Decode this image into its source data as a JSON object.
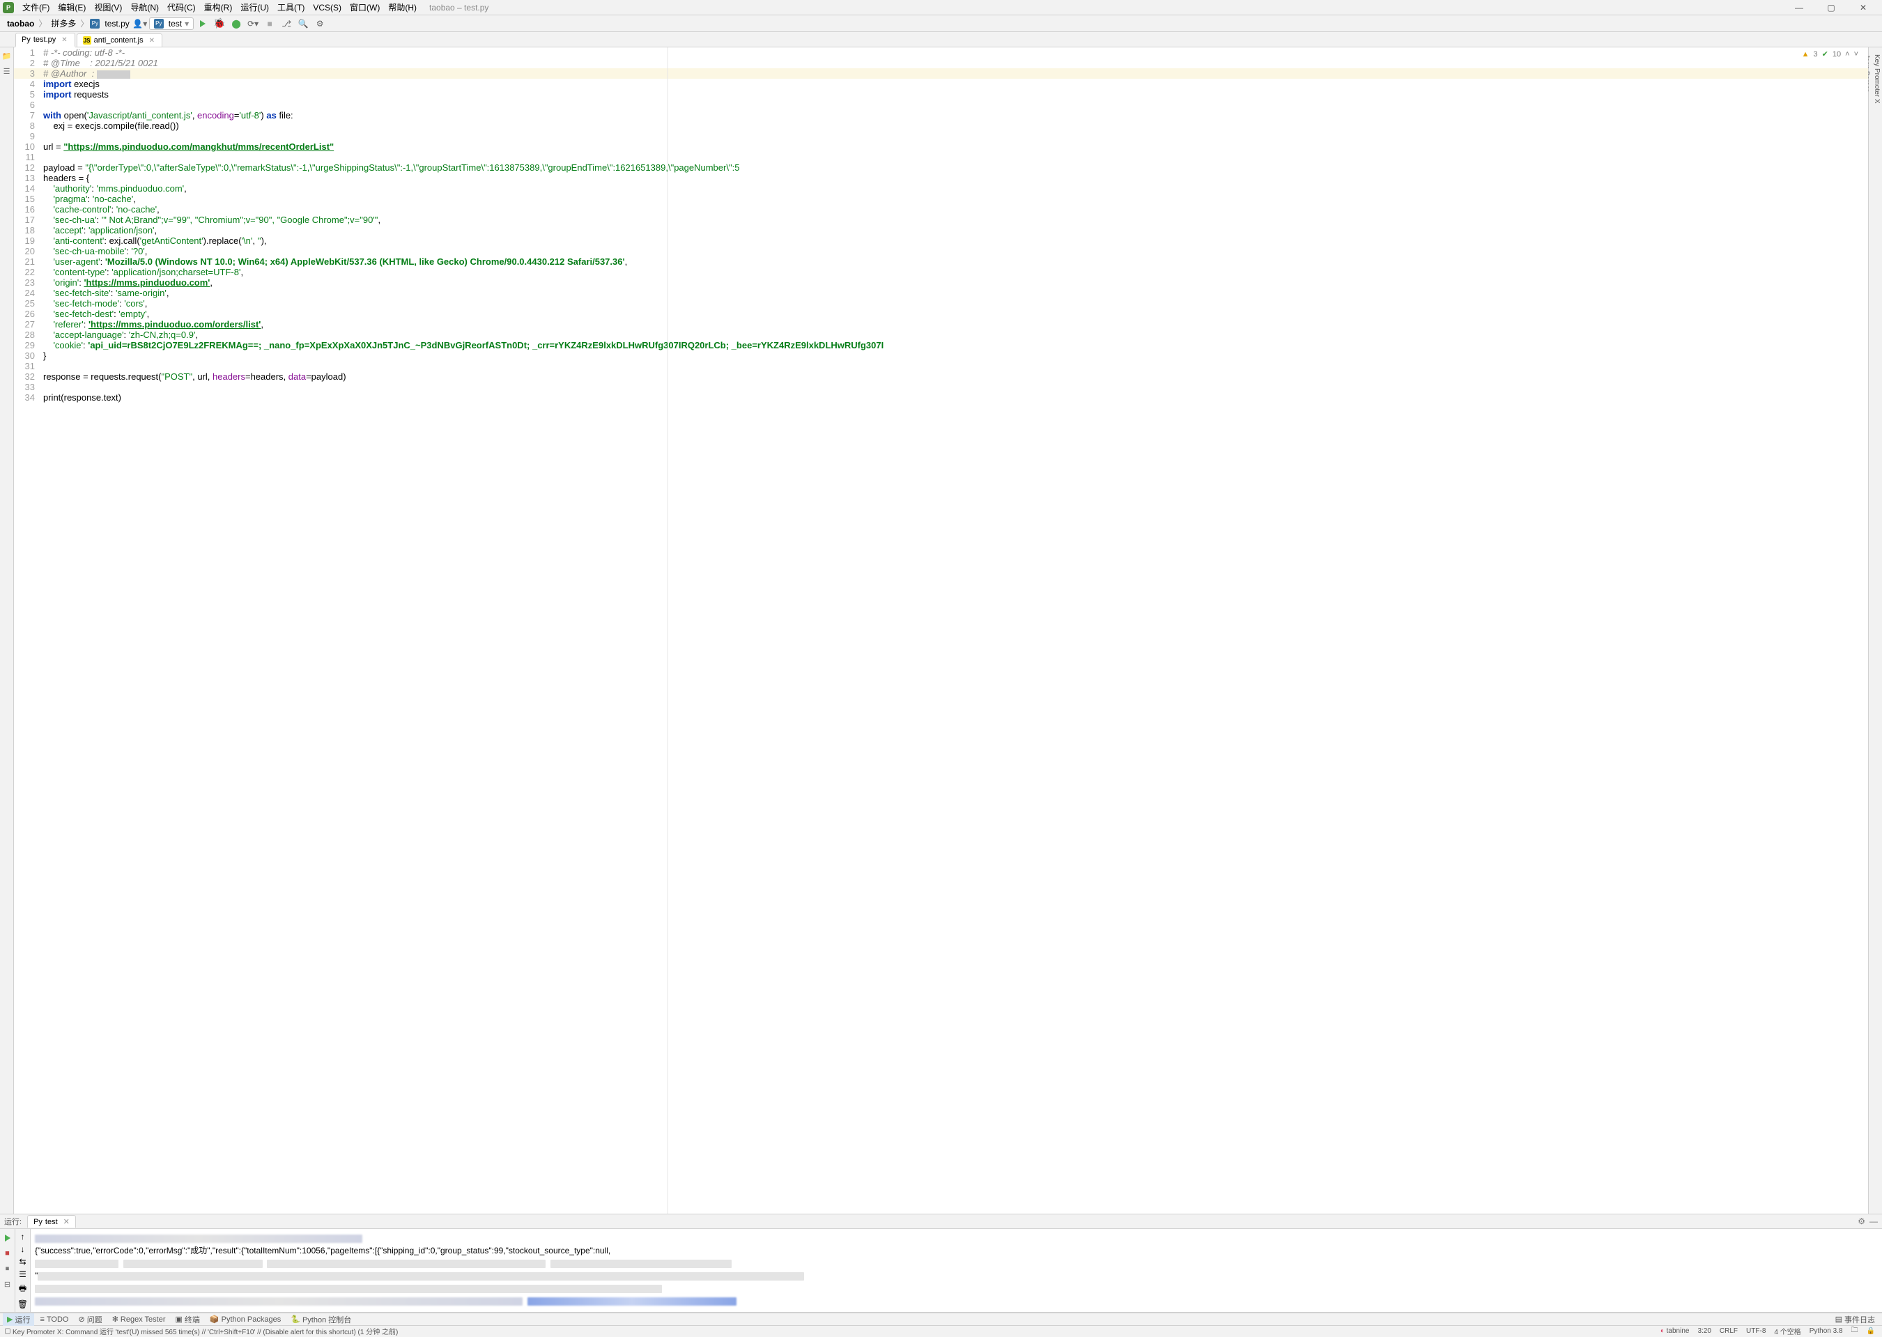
{
  "window": {
    "title": "taobao – test.py"
  },
  "menu": {
    "items": [
      "文件(F)",
      "编辑(E)",
      "视图(V)",
      "导航(N)",
      "代码(C)",
      "重构(R)",
      "运行(U)",
      "工具(T)",
      "VCS(S)",
      "窗口(W)",
      "帮助(H)"
    ]
  },
  "breadcrumb": {
    "a": "taobao",
    "b": "拼多多",
    "c": "test.py"
  },
  "run": {
    "conf": "test"
  },
  "tabs": [
    {
      "icon": "py",
      "label": "test.py",
      "active": true
    },
    {
      "icon": "js",
      "label": "anti_content.js",
      "active": false
    }
  ],
  "inspection": {
    "warnings": "3",
    "ok": "10"
  },
  "code": {
    "l1": "# -*- coding: utf-8 -*-",
    "l2": "# @Time    : 2021/5/21 0021",
    "l3a": "# @Author  : ",
    "l5_1": "import",
    "l5_2": " execjs",
    "l6_1": "import",
    "l6_2": " requests",
    "l7_1": "with",
    "l7_2": " open(",
    "l7_3": "'Javascript/anti_content.js'",
    "l7_4": ", ",
    "l7_5": "encoding",
    "l7_6": "=",
    "l7_7": "'utf-8'",
    "l7_8": ") ",
    "l7_9": "as",
    "l7_10": " file:",
    "l8": "    exj = execjs.compile(file.read())",
    "l10_1": "url = ",
    "l10_2": "\"https://mms.pinduoduo.com/mangkhut/mms/recentOrderList\"",
    "l12_1": "payload = ",
    "l12_2": "\"{\\\"orderType\\\":0,\\\"afterSaleType\\\":0,\\\"remarkStatus\\\":-1,\\\"urgeShippingStatus\\\":-1,\\\"groupStartTime\\\":1613875389,\\\"groupEndTime\\\":1621651389,\\\"pageNumber\\\":5",
    "l13": "headers = {",
    "l14_1": "    ",
    "l14_k": "'authority'",
    "l14_c": ": ",
    "l14_v": "'mms.pinduoduo.com'",
    "l14_e": ",",
    "l15_k": "'pragma'",
    "l15_v": "'no-cache'",
    "l16_k": "'cache-control'",
    "l16_v": "'no-cache'",
    "l17_k": "'sec-ch-ua'",
    "l17_v": "'\" Not A;Brand\";v=\"99\", \"Chromium\";v=\"90\", \"Google Chrome\";v=\"90\"'",
    "l18_k": "'accept'",
    "l18_v": "'application/json'",
    "l19_k": "'anti-content'",
    "l19_m": ": exj.call(",
    "l19_v": "'getAntiContent'",
    "l19_m2": ").replace(",
    "l19_a": "'\\n'",
    "l19_b": "''",
    "l19_e": "),",
    "l20_k": "'sec-ch-ua-mobile'",
    "l20_v": "'?0'",
    "l21_k": "'user-agent'",
    "l21_v": "'Mozilla/5.0 (Windows NT 10.0; Win64; x64) AppleWebKit/537.36 (KHTML, like Gecko) Chrome/90.0.4430.212 Safari/537.36'",
    "l22_k": "'content-type'",
    "l22_v": "'application/json;charset=UTF-8'",
    "l23_k": "'origin'",
    "l23_v": "'https://mms.pinduoduo.com'",
    "l24_k": "'sec-fetch-site'",
    "l24_v": "'same-origin'",
    "l25_k": "'sec-fetch-mode'",
    "l25_v": "'cors'",
    "l26_k": "'sec-fetch-dest'",
    "l26_v": "'empty'",
    "l27_k": "'referer'",
    "l27_v": "'https://mms.pinduoduo.com/orders/list'",
    "l28_k": "'accept-language'",
    "l28_v": "'zh-CN,zh;q=0.9'",
    "l29_k": "'cookie'",
    "l29_v": "'api_uid=rBS8t2CjO7E9Lz2FREKMAg==; _nano_fp=XpExXpXaX0XJn5TJnC_~P3dNBvGjReorfASTn0Dt; _crr=rYKZ4RzE9lxkDLHwRUfg307IRQ20rLCb; _bee=rYKZ4RzE9lxkDLHwRUfg307I",
    "l30": "}",
    "l32_1": "response = requests.request(",
    "l32_2": "\"POST\"",
    "l32_3": ", url, ",
    "l32_4": "headers",
    "l32_5": "=headers, ",
    "l32_6": "data",
    "l32_7": "=payload)",
    "l34": "print(response.text)"
  },
  "run_window": {
    "title": "运行:",
    "tab": "test",
    "output_line": "{\"success\":true,\"errorCode\":0,\"errorMsg\":\"成功\",\"result\":{\"totalItemNum\":10056,\"pageItems\":[{\"shipping_id\":0,\"group_status\":99,\"stockout_source_type\":null,"
  },
  "bottom_tabs": {
    "run": "运行",
    "todo": "TODO",
    "problems": "问题",
    "regex": "Regex Tester",
    "terminal": "终端",
    "pypkg": "Python Packages",
    "pycon": "Python 控制台",
    "eventlog": "事件日志"
  },
  "status": {
    "msg": "Key Promoter X: Command 运行 'test'(U) missed 565 time(s) // 'Ctrl+Shift+F10' // (Disable alert for this shortcut) (1 分钟 之前)",
    "tabnine": "tabnine",
    "pos": "3:20",
    "eol": "CRLF",
    "enc": "UTF-8",
    "indent": "4 个空格",
    "py": "Python 3.8"
  }
}
